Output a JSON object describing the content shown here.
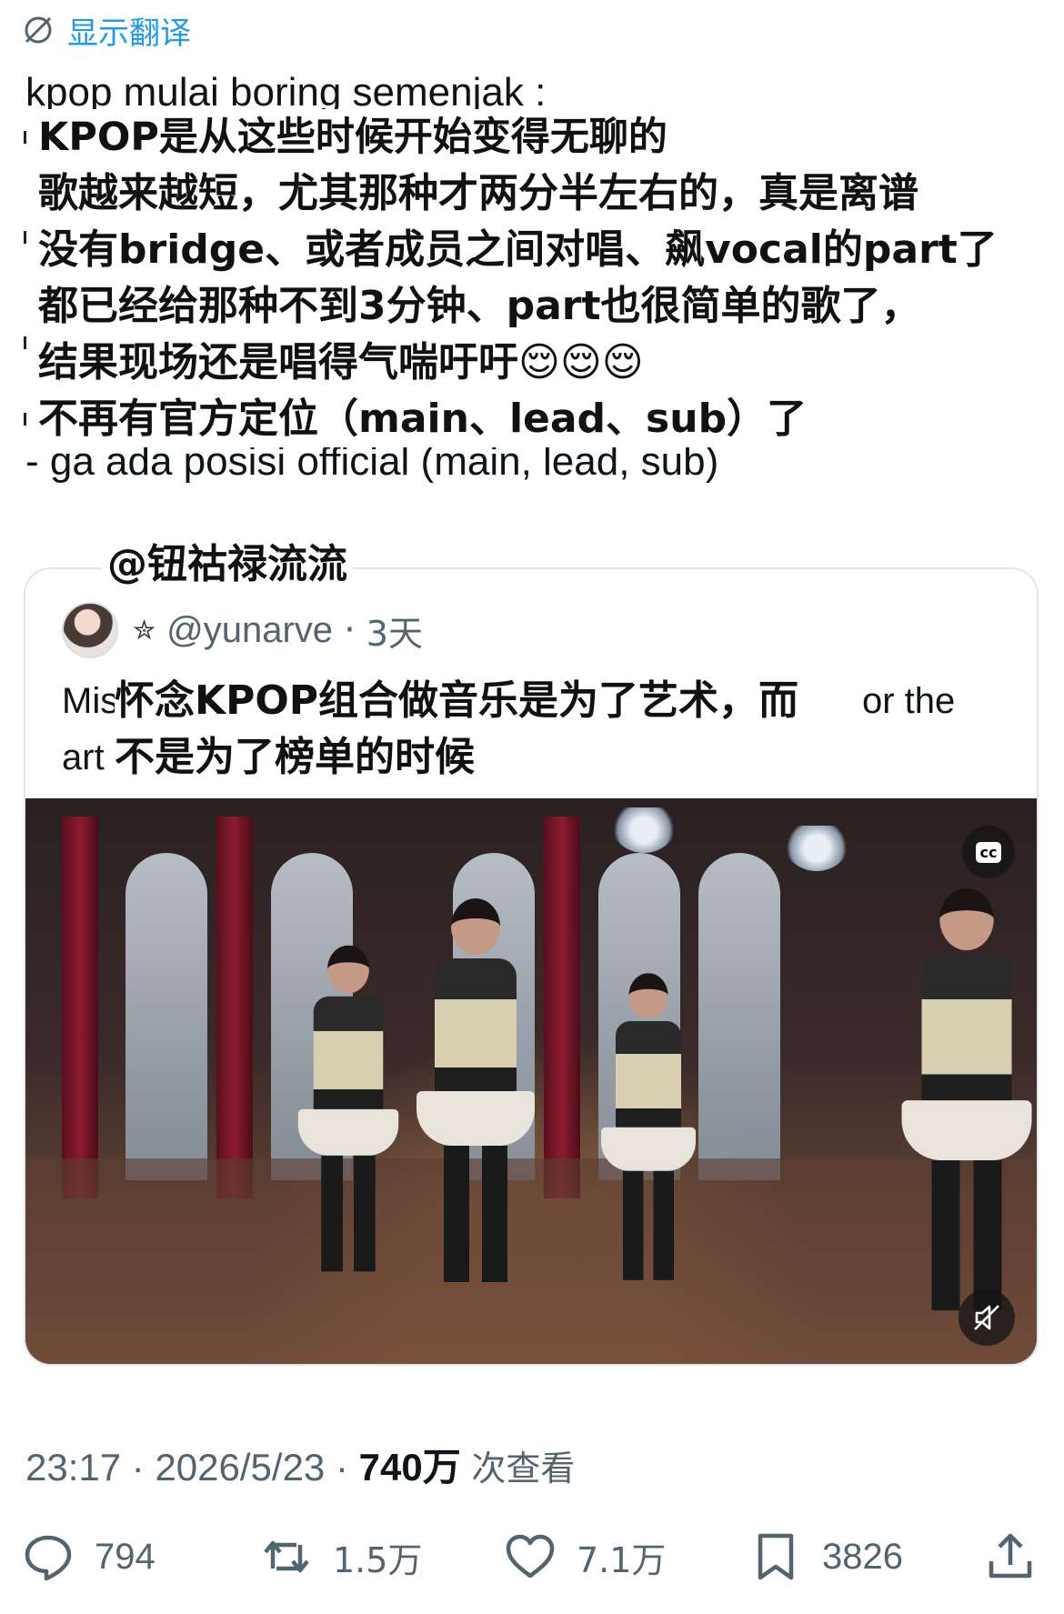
{
  "translate": {
    "icon": "globe-slash-icon",
    "label": "显示翻译"
  },
  "tweet": {
    "original_first_line": "kpop mulai boring semenjak :",
    "overlay_lines": [
      "KPOP是从这些时候开始变得无聊的",
      "歌越来越短，尤其那种才两分半左右的，真是离谱",
      "没有bridge、或者成员之间对唱、飙vocal的part了",
      "都已经给那种不到3分钟、part也很简单的歌了，",
      "结果现场还是唱得气喘吁吁😌😌😌",
      "不再有官方定位（main、lead、sub）了"
    ],
    "original_last_line": "- ga ada posisi official (main, lead, sub)"
  },
  "credit_tag": "@钮祜禄流流",
  "quote": {
    "badge_icon": "star-badge-icon",
    "handle": "@yunarve",
    "separator": "·",
    "age": "3天",
    "line1_prefix": "Mis",
    "line1_suffix": "or the",
    "line2_prefix": "art",
    "overlay_line1": "怀念KPOP组合做音乐是为了艺术，而",
    "overlay_line2": "不是为了榜单的时候",
    "cc_label": "cc"
  },
  "meta": {
    "time": "23:17",
    "separator": " · ",
    "date": "2026/5/23",
    "views": "740万",
    "views_label": "次查看"
  },
  "actions": {
    "replies": "794",
    "reposts": "1.5万",
    "likes": "7.1万",
    "bookmarks": "3826"
  },
  "colors": {
    "accent": "#1d9bf0",
    "secondary_text": "#536471",
    "primary_text": "#0f1419"
  }
}
